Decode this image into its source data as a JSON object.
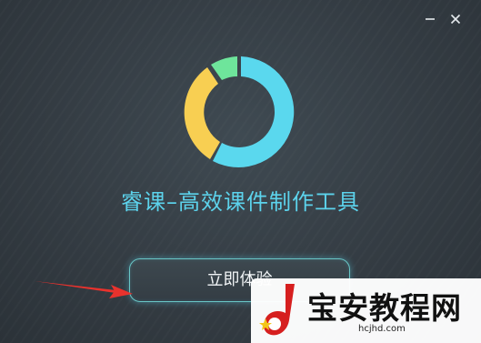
{
  "window": {
    "minimize_icon": "minimize-icon",
    "close_icon": "close-icon"
  },
  "logo": {
    "colors": {
      "cyan": "#5ad8ee",
      "yellow": "#f8cf52",
      "green": "#6ee59b"
    }
  },
  "app_title": "睿课–高效课件制作工具",
  "start_button": {
    "label": "立即体验"
  },
  "annotation": {
    "arrow_color": "#e8322d"
  },
  "watermark": {
    "text": "宝安教程网",
    "url": "hcjhd.com"
  },
  "colors": {
    "title": "#5cd3ec",
    "button_border": "#69c6c6",
    "background": "#343c43"
  }
}
